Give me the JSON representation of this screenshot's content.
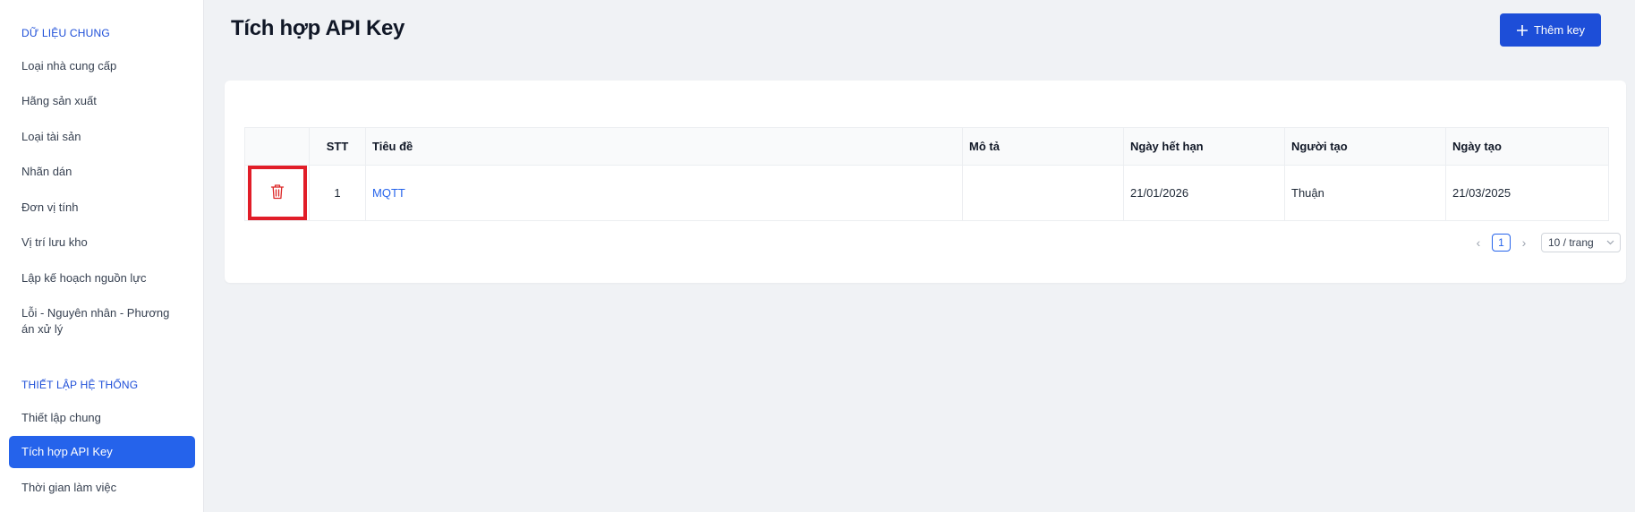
{
  "sidebar": {
    "section1_title": "DỮ LIỆU CHUNG",
    "items1": [
      {
        "label": "Loại nhà cung cấp"
      },
      {
        "label": "Hãng sản xuất"
      },
      {
        "label": "Loại tài sản"
      },
      {
        "label": "Nhãn dán"
      },
      {
        "label": "Đơn vị tính"
      },
      {
        "label": "Vị trí lưu kho"
      },
      {
        "label": "Lập kế hoạch nguồn lực"
      },
      {
        "label": "Lỗi - Nguyên nhân - Phương án xử lý"
      }
    ],
    "section2_title": "THIẾT LẬP HỆ THỐNG",
    "items2": [
      {
        "label": "Thiết lập chung"
      },
      {
        "label": "Tích hợp API Key",
        "active": true
      },
      {
        "label": "Thời gian làm việc"
      }
    ]
  },
  "header": {
    "title": "Tích hợp API Key",
    "add_button_label": "Thêm key",
    "add_icon": "plus-icon"
  },
  "table": {
    "columns": [
      "",
      "STT",
      "Tiêu đề",
      "Mô tả",
      "Ngày hết hạn",
      "Người tạo",
      "Ngày tạo"
    ],
    "rows": [
      {
        "action_icon": "trash-icon",
        "stt": "1",
        "title": "MQTT",
        "description": "",
        "expires": "21/01/2026",
        "creator": "Thuận",
        "created": "21/03/2025"
      }
    ]
  },
  "pagination": {
    "current_page": "1",
    "page_size": "10 / trang"
  },
  "colors": {
    "accent": "#1d4ed8",
    "active_item": "#2563eb",
    "delete_icon": "#dc2626",
    "highlight_box": "#e11d28"
  }
}
